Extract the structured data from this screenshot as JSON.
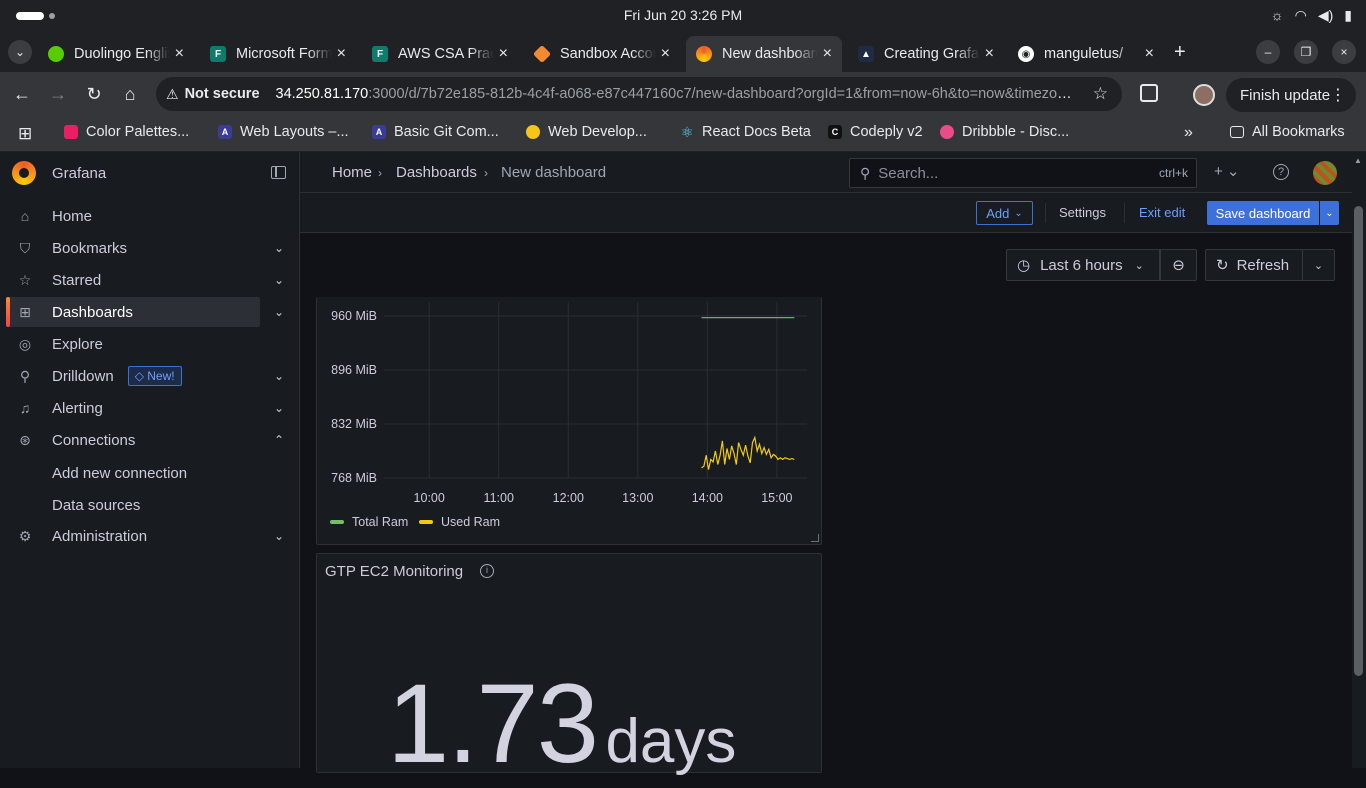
{
  "os": {
    "clock": "Fri Jun 20   3:26 PM",
    "tray_icons": [
      "brightness-icon",
      "wifi-icon",
      "volume-icon",
      "battery-icon"
    ]
  },
  "browser": {
    "tabs": [
      {
        "title": "Duolingo English",
        "favicon_color": "#58cc02",
        "active": false
      },
      {
        "title": "Microsoft Forms",
        "favicon_color": "#0f7b6c",
        "active": false
      },
      {
        "title": "AWS CSA Practice",
        "favicon_color": "#0f7b6c",
        "active": false
      },
      {
        "title": "Sandbox Account",
        "favicon_color": "#f28b30",
        "active": false
      },
      {
        "title": "New dashboard",
        "favicon_color": "#f05a28",
        "active": true
      },
      {
        "title": "Creating Grafana",
        "favicon_color": "#1f2a44",
        "active": false
      },
      {
        "title": "manguletus/",
        "favicon_color": "#ffffff",
        "active": false
      }
    ],
    "not_secure_label": "Not secure",
    "url_host": "34.250.81.170",
    "url_rest": ":3000/d/7b72e185-812b-4c4f-a068-e87c447160c7/new-dashboard?orgId=1&from=now-6h&to=now&timezone=browser",
    "finish_update_label": "Finish update",
    "bookmarks": [
      {
        "label": "Color Palettes...",
        "color": "#e91e63"
      },
      {
        "label": "Web Layouts –...",
        "color": "#3b3b98"
      },
      {
        "label": "Basic Git Com...",
        "color": "#3b3b98"
      },
      {
        "label": "Web Develop...",
        "color": "#f5c518"
      },
      {
        "label": "React Docs Beta",
        "color": "#61dafb"
      },
      {
        "label": "Codeply v2",
        "color": "#111111"
      },
      {
        "label": "Dribbble - Disc...",
        "color": "#ea4c89"
      }
    ],
    "all_bookmarks_label": "All Bookmarks"
  },
  "grafana": {
    "brand": "Grafana",
    "nav": [
      {
        "label": "Home",
        "icon": "home-icon",
        "expandable": false
      },
      {
        "label": "Bookmarks",
        "icon": "bookmark-icon",
        "expandable": true
      },
      {
        "label": "Starred",
        "icon": "star-icon",
        "expandable": true
      },
      {
        "label": "Dashboards",
        "icon": "apps-icon",
        "expandable": true,
        "active": true
      },
      {
        "label": "Explore",
        "icon": "compass-icon",
        "expandable": false
      },
      {
        "label": "Drilldown",
        "icon": "microscope-icon",
        "expandable": true,
        "badge": "New!"
      },
      {
        "label": "Alerting",
        "icon": "bell-icon",
        "expandable": true
      },
      {
        "label": "Connections",
        "icon": "connections-icon",
        "expandable": true,
        "expanded": true
      },
      {
        "label": "Administration",
        "icon": "cog-icon",
        "expandable": true
      }
    ],
    "connections_sub": [
      "Add new connection",
      "Data sources"
    ],
    "breadcrumb": [
      "Home",
      "Dashboards",
      "New dashboard"
    ],
    "search_placeholder": "Search...",
    "search_shortcut": "ctrl+k",
    "toolbar": {
      "add": "Add",
      "settings": "Settings",
      "exit_edit": "Exit edit",
      "save": "Save dashboard"
    },
    "time_range": "Last 6 hours",
    "refresh": "Refresh",
    "panel2": {
      "title": "GTP EC2 Monitoring",
      "value": "1.73",
      "unit": "days"
    }
  },
  "chart_data": {
    "type": "line",
    "title": "",
    "xlabel": "",
    "ylabel": "",
    "x_ticks": [
      "10:00",
      "11:00",
      "12:00",
      "13:00",
      "14:00",
      "15:00"
    ],
    "y_ticks": [
      "960 MiB",
      "896 MiB",
      "832 MiB",
      "768 MiB"
    ],
    "ylim": [
      768,
      960
    ],
    "xlim": [
      "09:21",
      "15:26"
    ],
    "legend_position": "bottom-left",
    "series": [
      {
        "name": "Total Ram",
        "color": "#73bf69",
        "x": [
          "13:55",
          "15:15"
        ],
        "y": [
          958,
          958
        ]
      },
      {
        "name": "Used Ram",
        "color": "#f2cc0c",
        "x": [
          "13:55",
          "13:57",
          "13:59",
          "14:01",
          "14:03",
          "14:05",
          "14:07",
          "14:09",
          "14:11",
          "14:13",
          "14:15",
          "14:17",
          "14:19",
          "14:21",
          "14:23",
          "14:25",
          "14:27",
          "14:29",
          "14:31",
          "14:33",
          "14:35",
          "14:37",
          "14:39",
          "14:41",
          "14:43",
          "14:45",
          "14:47",
          "14:49",
          "14:51",
          "14:53",
          "14:55",
          "14:57",
          "14:59",
          "15:01",
          "15:03",
          "15:05",
          "15:07",
          "15:09",
          "15:11",
          "15:13",
          "15:15"
        ],
        "y": [
          780,
          782,
          795,
          778,
          790,
          787,
          800,
          784,
          795,
          812,
          784,
          803,
          790,
          806,
          797,
          784,
          810,
          802,
          795,
          807,
          794,
          786,
          810,
          816,
          800,
          808,
          797,
          804,
          796,
          802,
          792,
          796,
          794,
          790,
          792,
          790,
          792,
          791,
          790,
          791,
          790
        ]
      }
    ]
  }
}
